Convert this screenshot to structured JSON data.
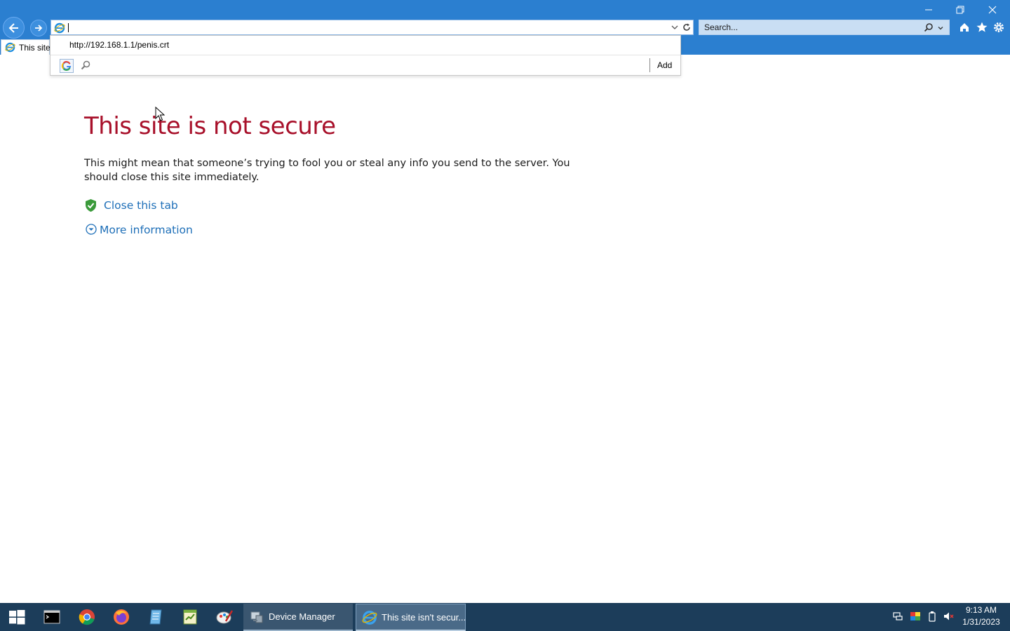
{
  "browser": {
    "tab_title": "This site",
    "address_value": "",
    "search_placeholder": "Search...",
    "accent": "#2b7fd0"
  },
  "autocomplete": {
    "suggestion": "http://192.168.1.1/penis.crt",
    "add_label": "Add"
  },
  "page": {
    "title": "This site is not secure",
    "body": "This might mean that someone’s trying to fool you or steal any info you send to the server. You should close this site immediately.",
    "close_link": "Close this tab",
    "more_link": "More information",
    "title_color": "#a8102a",
    "link_color": "#1e6fb8"
  },
  "taskbar": {
    "apps": [
      {
        "label": "Device Manager"
      },
      {
        "label": "This site isn't secur..."
      }
    ],
    "clock_time": "9:13 AM",
    "clock_date": "1/31/2023"
  }
}
